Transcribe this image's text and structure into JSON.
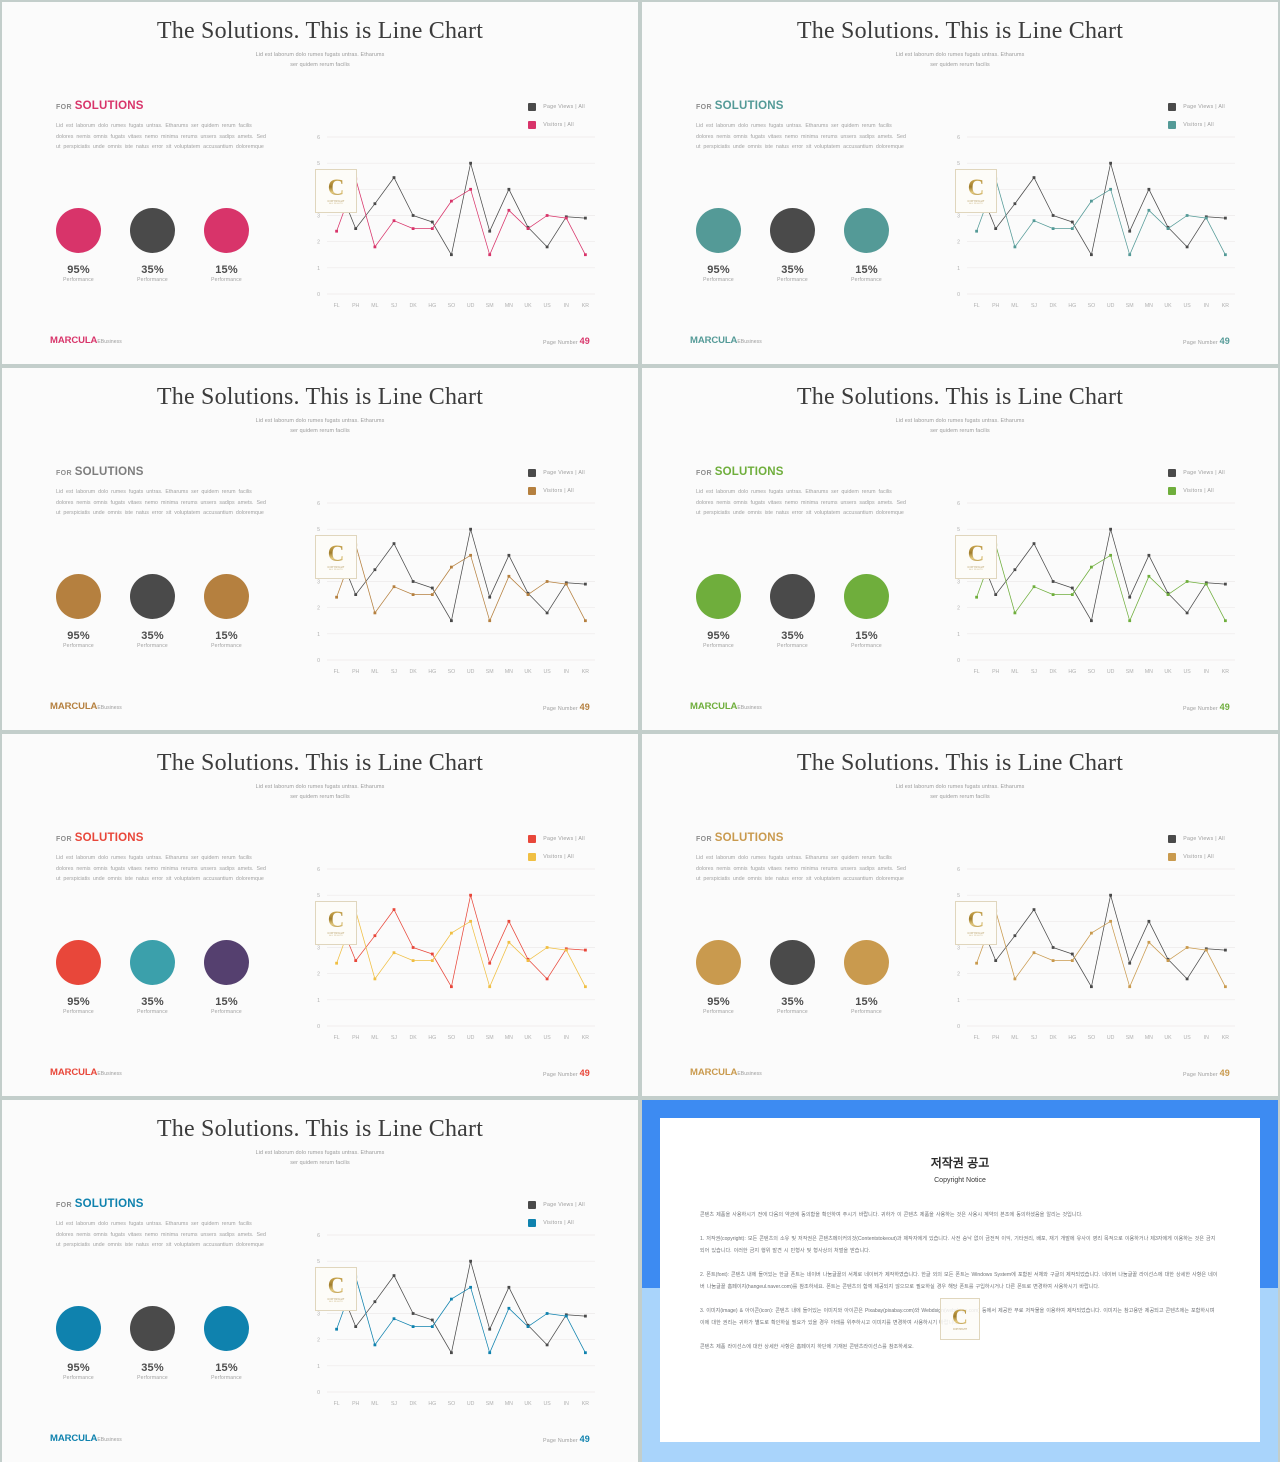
{
  "deck": {
    "title": "The Solutions. This is Line Chart",
    "subtitle_line1": "Lid est laborum dolo rumes fugats untras. Etharums",
    "subtitle_line2": "ser quidem rerum facilis",
    "section_for": "FOR",
    "section_word": "SOLUTIONS",
    "body_text": "Lid est laborum dolo rumes fugats untras. Etharums ser quidem rerum facilis dolores nemis omnis fugats vitaes nemo minima rerums unsers sadips amets. Sed ut perspiciatis unde omnis iste natus error sit voluptatem accusantium doloremque",
    "brand_main": "MARCULA",
    "brand_sub": "EBusiness",
    "page_label": "Page Number",
    "page_value": "49",
    "watermark_letter": "C",
    "watermark_text": "COPYRIGHT",
    "watermark_text2": "ALL RIGHTS",
    "stats": [
      {
        "value": "95%",
        "label": "Performance"
      },
      {
        "value": "35%",
        "label": "Performance"
      },
      {
        "value": "15%",
        "label": "Performance"
      }
    ],
    "legend": [
      {
        "label": "Page Views | All"
      },
      {
        "label": "Visitors | All"
      }
    ]
  },
  "chart_data": {
    "type": "line",
    "title": "The Solutions. This is Line Chart",
    "xlabel": "",
    "ylabel": "",
    "ylim": [
      0,
      6
    ],
    "yticks": [
      0,
      1,
      2,
      3,
      4,
      5,
      6
    ],
    "grid": true,
    "legend_position": "top-right",
    "categories": [
      "FL",
      "PH",
      "ML",
      "SJ",
      "DK",
      "HG",
      "SO",
      "UD",
      "SM",
      "MN",
      "UK",
      "US",
      "IN",
      "KR"
    ],
    "series": [
      {
        "name": "Page Views | All",
        "values": [
          4.3,
          2.5,
          3.45,
          4.45,
          3.0,
          2.75,
          1.5,
          5.0,
          2.4,
          4.0,
          2.55,
          1.8,
          2.95,
          2.9
        ]
      },
      {
        "name": "Visitors | All",
        "values": [
          2.4,
          4.4,
          1.8,
          2.8,
          2.5,
          2.5,
          3.55,
          4.0,
          1.5,
          3.2,
          2.5,
          3.0,
          2.9,
          1.5
        ]
      }
    ]
  },
  "slides": [
    {
      "id": 1,
      "accent": "#d8346a",
      "word_color": "#d8346a",
      "brand_color": "#d8346a",
      "page_num_color": "#d8346a",
      "circles": [
        "#d8346a",
        "#4a4a4a",
        "#d8346a"
      ],
      "line_colors": [
        "#4a4a4a",
        "#d8346a"
      ]
    },
    {
      "id": 2,
      "accent": "#549a97",
      "word_color": "#549a97",
      "brand_color": "#549a97",
      "page_num_color": "#549a97",
      "circles": [
        "#549a97",
        "#4a4a4a",
        "#549a97"
      ],
      "line_colors": [
        "#4a4a4a",
        "#549a97"
      ]
    },
    {
      "id": 3,
      "accent": "#b5803f",
      "word_color": "#7d7d7d",
      "brand_color": "#b5803f",
      "page_num_color": "#b5803f",
      "circles": [
        "#b5803f",
        "#4a4a4a",
        "#b5803f"
      ],
      "line_colors": [
        "#4a4a4a",
        "#b5803f"
      ]
    },
    {
      "id": 4,
      "accent": "#6fae3c",
      "word_color": "#6fae3c",
      "brand_color": "#6fae3c",
      "page_num_color": "#6fae3c",
      "circles": [
        "#6fae3c",
        "#4a4a4a",
        "#6fae3c"
      ],
      "line_colors": [
        "#4a4a4a",
        "#6fae3c"
      ]
    },
    {
      "id": 5,
      "accent": "#e8473a",
      "word_color": "#e8473a",
      "brand_color": "#e8473a",
      "page_num_color": "#e8473a",
      "circles": [
        "#e8473a",
        "#3ba0ab",
        "#55406f"
      ],
      "line_colors": [
        "#e8473a",
        "#f0bf43"
      ]
    },
    {
      "id": 6,
      "accent": "#c99a4e",
      "word_color": "#c99a4e",
      "brand_color": "#c99a4e",
      "page_num_color": "#c99a4e",
      "circles": [
        "#c99a4e",
        "#4a4a4a",
        "#c99a4e"
      ],
      "line_colors": [
        "#4a4a4a",
        "#c99a4e"
      ]
    },
    {
      "id": 7,
      "accent": "#0f82ae",
      "word_color": "#0f82ae",
      "brand_color": "#0f82ae",
      "page_num_color": "#0f82ae",
      "circles": [
        "#0f82ae",
        "#4a4a4a",
        "#0f82ae"
      ],
      "line_colors": [
        "#4a4a4a",
        "#0f82ae"
      ]
    }
  ],
  "copyright": {
    "title_ko": "저작권 공고",
    "title_en": "Copyright Notice",
    "intro": "콘텐츠 제품을 사용하시기 전에 다음의 약관에 동의함을 확인하여 주시기 바랍니다. 귀하가 이 콘텐츠 제품을 사용하는 것은 사용시 계약의 본조에 동의하셨음을 알리는 것입니다.",
    "p1": "1. 저작권(copyright): 모든 콘텐츠의 소유 및 저작권은 콘텐츠메이커의것(Contentstokeout)과 제작자에게 있습니다. 사전 승낙 없이 금전적 이익, 기타권리, 배포, 재기 개발에 유사이 영리 목적으로 이용하거나 제3자에게 이용하는 것은 금지되어 있습니다. 이러한 금지 행위 발견 시 민형사 및 형사상의 처벌을 받습니다.",
    "p2": "2. 폰트(font): 콘텐츠 내에 들어있는 한글 폰트는 네이버 나눔글꼴의 서체로 네이버가 제작하였습니다. 한글 외의 모든 폰트는 Windows System에 포함된 서체와 구글의 제작되었습니다. 네이버 나눔글꼴 라이선스에 대한 상세한 사항은 네이버 나눔글꼴 홈페이지(hangeul.naver.com)를 참조하세요. 폰트는 콘텐츠의 함께 제공되지 않으므로 필요하실 경우 해당 폰트를 구입하시거나 다른 폰트로 변경하여 사용하시기 바랍니다.",
    "p3": "3. 이미지(image) & 아이콘(icon): 콘텐츠 내에 들어있는 이미지와 아이콘은 Pixabay(pixabay.com)와 Webdsign(webdsign.com) 등에서 제공한 무료 저작물을 이용하여 제작되었습니다. 이미지는 참고용만 제공되고 콘텐츠에는 포함하시며 이에 대한 권리는 귀하가 별도로 확인하실 필요가 있을 경우 아래를 위주하시고 이미지를 변경하여 사용하시기 바랍니다.",
    "p4": "콘텐츠 제품 라이선스에 대한 상세한 사항은 홈페이지 하단에 기재된 콘텐츠라이선스를 참조하세요."
  }
}
